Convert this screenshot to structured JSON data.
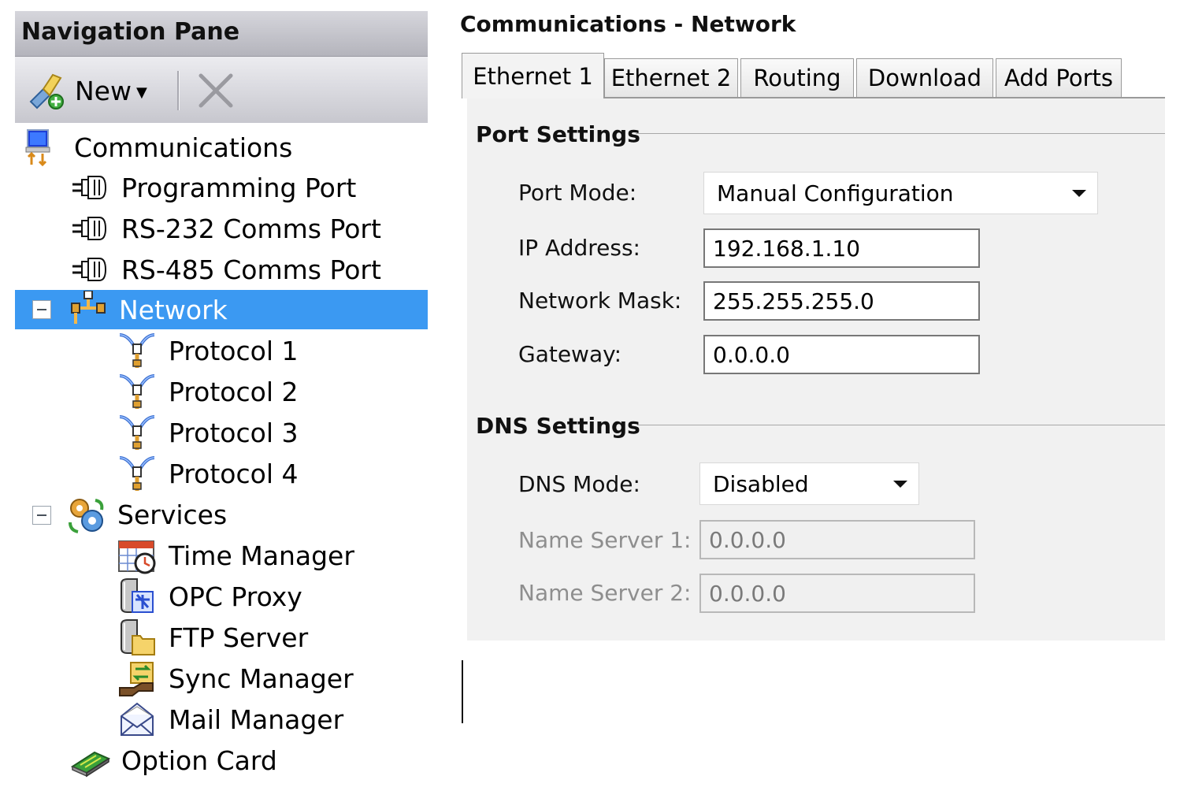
{
  "nav": {
    "title": "Navigation Pane",
    "toolbar": {
      "new_label": "New",
      "new_icon": "new-item-icon",
      "delete_icon": "delete-icon"
    },
    "tree": [
      {
        "label": "Communications",
        "icon": "communications-icon"
      },
      {
        "label": "Programming Port",
        "icon": "port-icon"
      },
      {
        "label": "RS-232 Comms Port",
        "icon": "port-icon"
      },
      {
        "label": "RS-485 Comms Port",
        "icon": "port-icon"
      },
      {
        "label": "Network",
        "icon": "network-icon",
        "selected": true,
        "expanded": true
      },
      {
        "label": "Protocol 1",
        "icon": "protocol-icon"
      },
      {
        "label": "Protocol 2",
        "icon": "protocol-icon"
      },
      {
        "label": "Protocol 3",
        "icon": "protocol-icon"
      },
      {
        "label": "Protocol 4",
        "icon": "protocol-icon"
      },
      {
        "label": "Services",
        "icon": "services-icon",
        "expanded": true
      },
      {
        "label": "Time Manager",
        "icon": "time-manager-icon"
      },
      {
        "label": "OPC Proxy",
        "icon": "opc-proxy-icon"
      },
      {
        "label": "FTP Server",
        "icon": "ftp-server-icon"
      },
      {
        "label": "Sync Manager",
        "icon": "sync-manager-icon"
      },
      {
        "label": "Mail Manager",
        "icon": "mail-manager-icon"
      },
      {
        "label": "Option Card",
        "icon": "option-card-icon"
      }
    ],
    "selection_color": "#3b99f2"
  },
  "panel": {
    "title": "Communications - Network",
    "tabs": [
      {
        "label": "Ethernet 1",
        "active": true
      },
      {
        "label": "Ethernet 2"
      },
      {
        "label": "Routing"
      },
      {
        "label": "Download"
      },
      {
        "label": "Add Ports"
      }
    ],
    "port_settings": {
      "title": "Port Settings",
      "port_mode_label": "Port Mode:",
      "port_mode_value": "Manual Configuration",
      "ip_label": "IP Address:",
      "ip_value": "192.168.1.10",
      "mask_label": "Network Mask:",
      "mask_value": "255.255.255.0",
      "gateway_label": "Gateway:",
      "gateway_value": "0.0.0.0"
    },
    "dns_settings": {
      "title": "DNS Settings",
      "dns_mode_label": "DNS Mode:",
      "dns_mode_value": "Disabled",
      "ns1_label": "Name Server 1:",
      "ns1_value": "0.0.0.0",
      "ns2_label": "Name Server 2:",
      "ns2_value": "0.0.0.0"
    }
  }
}
